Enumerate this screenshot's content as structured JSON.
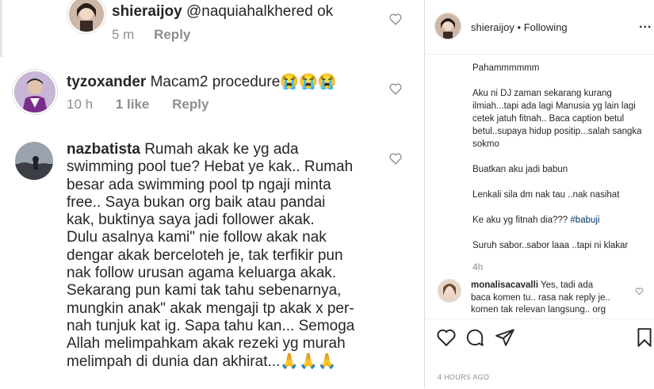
{
  "left_panel": {
    "reply_comment": {
      "username": "shieraijoy",
      "mention": "@naquiahalkhered",
      "text": "ok",
      "time": "5 m",
      "reply_label": "Reply"
    },
    "comment1": {
      "username": "tyzoxander",
      "text": "Macam2 procedure😭😭😭",
      "time": "10 h",
      "likes": "1 like",
      "reply_label": "Reply"
    },
    "comment2": {
      "username": "nazbatista",
      "lines": [
        "Rumah akak ke yg ada",
        "swimming pool tue? Hebat ye kak.. Rumah",
        "besar ada swimming pool tp ngaji minta",
        "free.. Saya bukan org baik atau pandai",
        "kak, buktinya saya jadi follower akak.",
        "Dulu asalnya kami\" nie follow akak nak",
        "dengar akak berceloteh je, tak terfikir pun",
        "nak follow urusan agama keluarga akak.",
        "Sekarang pun kami tak tahu sebenarnya,",
        "mungkin anak\" akak mengaji tp akak x per-",
        "nah tunjuk kat ig. Sapa tahu kan... Semoga",
        "Allah melimpahkam akak rezeki yg murah",
        "melimpah di dunia dan akhirat...🙏🙏🙏"
      ]
    }
  },
  "right_panel": {
    "header": {
      "username": "shieraijoy",
      "separator": "•",
      "follow_status": "Following",
      "more": "..."
    },
    "caption": [
      "Pahammmmmm",
      "Aku ni DJ zaman sekarang kurang ilmiah...tapi ada lagi Manusia yg lain lagi cetek jatuh fitnah.. Baca caption betul betul..supaya hidup positip...salah sangka sokmo",
      "Buatkan aku jadi babun",
      "Lenkali sila dm nak tau ..nak nasihat",
      "Ke aku yg fitnah dia??? ",
      "Suruh sabor..sabor laaa ..tapi ni klakar"
    ],
    "hashtag": "#babuji",
    "caption_time": "4h",
    "comment": {
      "username": "monalisacavalli",
      "text_line1": "Yes, tadi ada",
      "text_line2": "baca komen tu.. rasa nak reply je..",
      "text_line3": "komen tak relevan langsung.. org"
    },
    "post_time": "4 HOURS AGO"
  },
  "colors": {
    "text": "#262626",
    "muted": "#8e8e8e",
    "border": "#dbdbdb",
    "hashtag": "#00376b"
  },
  "icons": [
    "heart-icon",
    "comment-icon",
    "share-icon",
    "bookmark-icon",
    "more-icon"
  ]
}
